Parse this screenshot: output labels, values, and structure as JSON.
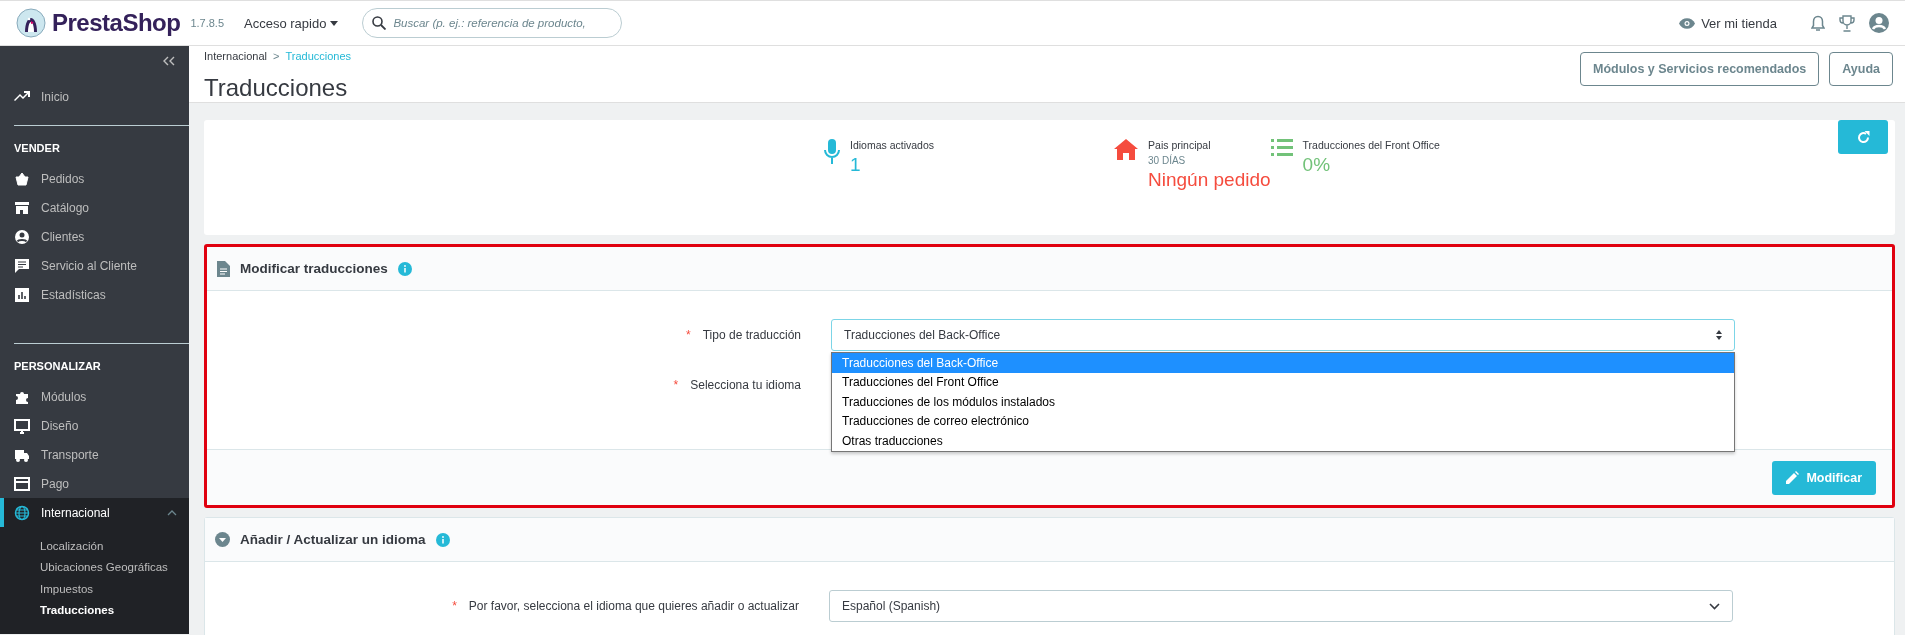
{
  "header": {
    "logo": "PrestaShop",
    "version": "1.7.8.5",
    "quick_access": "Acceso rapido",
    "search": {
      "placeholder": "Buscar (p. ej.: referencia de producto,"
    },
    "view_store": "Ver mi tienda"
  },
  "sidebar": {
    "groups": [
      {
        "items": [
          {
            "label": "Inicio",
            "selected": false
          }
        ]
      },
      {
        "title": "VENDER",
        "items": [
          {
            "label": "Pedidos",
            "selected": false
          },
          {
            "label": "Catálogo",
            "selected": false
          },
          {
            "label": "Clientes",
            "selected": false
          },
          {
            "label": "Servicio al Cliente",
            "selected": false
          },
          {
            "label": "Estadísticas",
            "selected": false
          }
        ]
      },
      {
        "title": "PERSONALIZAR",
        "items": [
          {
            "label": "Módulos",
            "selected": false
          },
          {
            "label": "Diseño",
            "selected": false
          },
          {
            "label": "Transporte",
            "selected": false
          },
          {
            "label": "Pago",
            "selected": false
          },
          {
            "label": "Internacional",
            "selected": true,
            "expanded": true,
            "children": [
              {
                "label": "Localización",
                "selected": false
              },
              {
                "label": "Ubicaciones Geográficas",
                "selected": false
              },
              {
                "label": "Impuestos",
                "selected": false
              },
              {
                "label": "Traducciones",
                "selected": true
              }
            ]
          }
        ]
      }
    ]
  },
  "breadcrumb": {
    "separator": ">",
    "items": [
      {
        "label": "Internacional",
        "selected": false
      },
      {
        "label": "Traducciones",
        "selected": true
      }
    ]
  },
  "page_title": "Traducciones",
  "toolbar_buttons": [
    "Módulos y Servicios recomendados",
    "Ayuda"
  ],
  "stats": [
    {
      "title": "Idiomas activados",
      "value": "1",
      "color": "#25b9d7"
    },
    {
      "title": "Pais principal",
      "subtitle": "30 DÍAS",
      "value": "Ningún pedido",
      "color": "#f54c3e"
    },
    {
      "title": "Traducciones del Front Office",
      "value": "0%",
      "color": "#72c279"
    }
  ],
  "panels": [
    {
      "title": "Modificar traducciones",
      "highlighted": true,
      "fields": [
        {
          "label": "Tipo de traducción",
          "required_mark": "*",
          "value": "Traducciones del Back-Office",
          "options": [
            {
              "label": "Traducciones del Back-Office",
              "selected": true
            },
            {
              "label": "Traducciones del Front Office",
              "selected": false
            },
            {
              "label": "Traducciones de los módulos instalados",
              "selected": false
            },
            {
              "label": "Traducciones de correo electrónico",
              "selected": false
            },
            {
              "label": "Otras traducciones",
              "selected": false
            }
          ]
        },
        {
          "label": "Selecciona tu idioma",
          "required_mark": "*"
        }
      ],
      "button": "Modificar"
    },
    {
      "title": "Añadir / Actualizar un idioma",
      "highlighted": false,
      "fields": [
        {
          "label": "Por favor, selecciona el idioma que quieres añadir o actualizar",
          "required_mark": "*",
          "value": "Español (Spanish)"
        }
      ]
    }
  ]
}
